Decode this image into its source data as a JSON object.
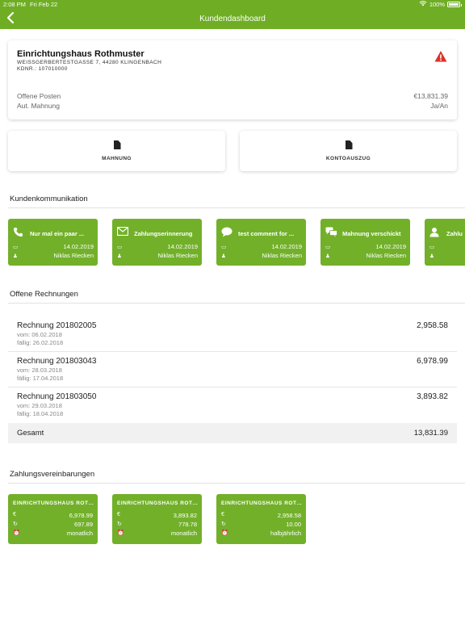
{
  "status_bar": {
    "time": "2:08 PM",
    "date": "Fri Feb 22",
    "battery": "100%"
  },
  "nav": {
    "title": "Kundendashboard",
    "back_icon": "chevron-left-icon"
  },
  "customer": {
    "name": "Einrichtungshaus Rothmuster",
    "address": "WEISSGERBERTESTGASSE 7, 44280 KLINGENBACH",
    "number": "KDNR.: 107010000",
    "open_items_label": "Offene Posten",
    "open_items_value": "€13,831.39",
    "auto_dunning_label": "Aut. Mahnung",
    "auto_dunning_value": "Ja/An",
    "warning_color": "#e0302a"
  },
  "actions": {
    "mahnung": "MAHNUNG",
    "kontoauszug": "KONTOAUSZUG"
  },
  "communication": {
    "title": "Kundenkommunikation",
    "items": [
      {
        "icon": "phone-icon",
        "title": "Nur mal ein paar ...",
        "date": "14.02.2019",
        "user": "Niklas Riecken"
      },
      {
        "icon": "envelope-icon",
        "title": "Zahlungserinnerung",
        "date": "14.02.2019",
        "user": "Niklas Riecken"
      },
      {
        "icon": "comment-icon",
        "title": "test comment for ...",
        "date": "14.02.2019",
        "user": "Niklas Riecken"
      },
      {
        "icon": "comments-icon",
        "title": "Mahnung verschickt",
        "date": "14.02.2019",
        "user": "Niklas Riecken"
      },
      {
        "icon": "user-icon",
        "title": "Zahlu",
        "date": "",
        "user": ""
      }
    ]
  },
  "invoices": {
    "title": "Offene Rechnungen",
    "items": [
      {
        "name": "Rechnung 201802005",
        "amount": "2,958.58",
        "from": "vom: 06.02.2018",
        "due": "fällig: 26.02.2018"
      },
      {
        "name": "Rechnung 201803043",
        "amount": "6,978.99",
        "from": "vom: 28.03.2018",
        "due": "fällig: 17.04.2018"
      },
      {
        "name": "Rechnung 201803050",
        "amount": "3,893.82",
        "from": "vom: 29.03.2018",
        "due": "fällig: 18.04.2018"
      }
    ],
    "total_label": "Gesamt",
    "total_value": "13,831.39"
  },
  "agreements": {
    "title": "Zahlungsvereinbarungen",
    "items": [
      {
        "title": "EINRICHTUNGSHAUS ROTHMUSTER",
        "total": "6,978.99",
        "rate": "697.89",
        "interval": "monatlich"
      },
      {
        "title": "EINRICHTUNGSHAUS ROTHMUSTER",
        "total": "3,893.82",
        "rate": "778.78",
        "interval": "monatlich"
      },
      {
        "title": "EINRICHTUNGSHAUS ROTHMUSTER",
        "total": "2,958.58",
        "rate": "10.00",
        "interval": "halbjährlich"
      }
    ]
  },
  "colors": {
    "brand_green": "#6fae24",
    "card_green": "#72b02a"
  }
}
